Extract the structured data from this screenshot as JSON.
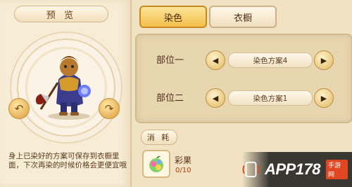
{
  "preview": {
    "title": "预 览",
    "hint": "身上已染好的方案可保存到衣橱里面，下次再染的时候价格会更便宜哦"
  },
  "tabs": [
    {
      "label": "染色",
      "active": true
    },
    {
      "label": "衣橱",
      "active": false
    }
  ],
  "parts": [
    {
      "label": "部位一",
      "scheme": "染色方案4"
    },
    {
      "label": "部位二",
      "scheme": "染色方案1"
    }
  ],
  "consume": {
    "label": "消 耗",
    "item_name": "彩果",
    "item_count": "0/10"
  },
  "watermark": {
    "text": "APP178",
    "sub": "手游网"
  },
  "colors": {
    "accent": "#f2bf4b",
    "panel": "#f0e2c3",
    "count_text": "#b23b14"
  }
}
